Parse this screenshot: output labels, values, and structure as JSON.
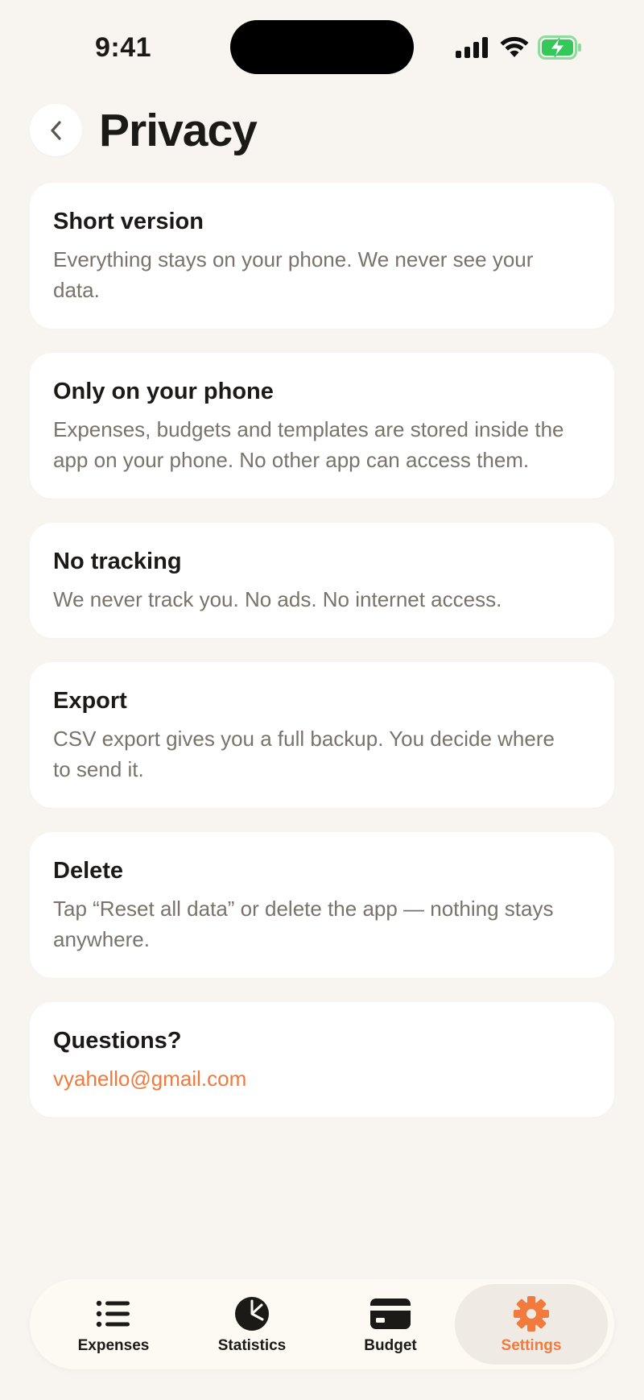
{
  "status_bar": {
    "time": "9:41",
    "icons": [
      "cellular-signal-icon",
      "wifi-icon",
      "battery-charging-icon"
    ],
    "battery_color": "#34c759"
  },
  "header": {
    "back_icon": "chevron-left-icon",
    "title": "Privacy"
  },
  "cards": [
    {
      "title": "Short version",
      "body": "Everything stays on your phone. We never see your data."
    },
    {
      "title": "Only on your phone",
      "body": "Expenses, budgets and templates are stored inside the app on your phone. No other app can access them."
    },
    {
      "title": "No tracking",
      "body": "We never track you. No ads. No internet access."
    },
    {
      "title": "Export",
      "body": "CSV export gives you a full backup. You decide where to send it."
    },
    {
      "title": "Delete",
      "body": "Tap “Reset all data” or delete the app — nothing stays anywhere."
    },
    {
      "title": "Questions?",
      "link": "vyahello@gmail.com"
    }
  ],
  "tab_bar": {
    "tabs": [
      {
        "label": "Expenses",
        "icon": "list-icon",
        "active": false
      },
      {
        "label": "Statistics",
        "icon": "pie-chart-icon",
        "active": false
      },
      {
        "label": "Budget",
        "icon": "credit-card-icon",
        "active": false
      },
      {
        "label": "Settings",
        "icon": "gear-icon",
        "active": true
      }
    ]
  },
  "colors": {
    "accent": "#ef7a3d",
    "background": "#f8f5f0",
    "card": "#ffffff",
    "body_text": "#79736b",
    "active_tab_background": "#efebe4"
  }
}
